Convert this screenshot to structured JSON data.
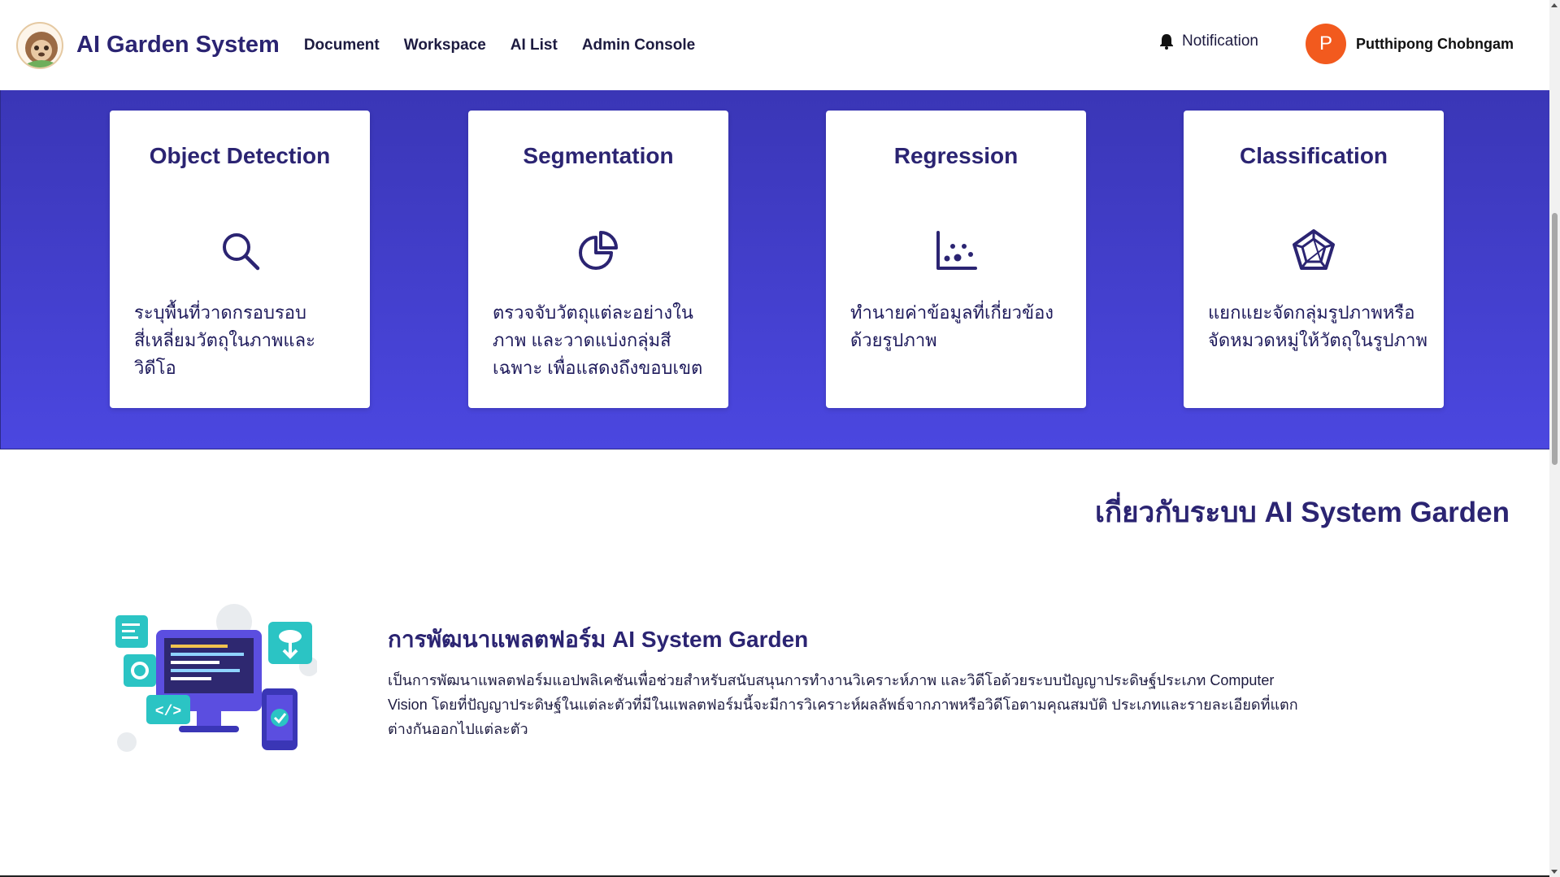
{
  "header": {
    "brand": "AI Garden System",
    "nav": [
      {
        "label": "Document"
      },
      {
        "label": "Workspace"
      },
      {
        "label": "AI List"
      },
      {
        "label": "Admin Console"
      }
    ],
    "notification_label": "Notification",
    "user": {
      "initial": "P",
      "name": "Putthipong Chobngam"
    }
  },
  "cards": [
    {
      "title": "Object Detection",
      "icon": "magnifier-icon",
      "description": "ระบุพื้นที่วาดกรอบรอบสี่เหลี่ยมวัตถุในภาพและวิดีโอ"
    },
    {
      "title": "Segmentation",
      "icon": "pie-chart-icon",
      "description": "ตรวจจับวัตถุแต่ละอย่างในภาพ และวาดแบ่งกลุ่มสีเฉพาะ เพื่อแสดงถึงขอบเขต"
    },
    {
      "title": "Regression",
      "icon": "scatter-chart-icon",
      "description": "ทำนายค่าข้อมูลที่เกี่ยวข้องด้วยรูปภาพ"
    },
    {
      "title": "Classification",
      "icon": "pentagon-network-icon",
      "description": "แยกแยะจัดกลุ่มรูปภาพหรือจัดหมวดหมู่ให้วัตถุในรูปภาพ"
    }
  ],
  "about": {
    "heading": "เกี่ยวกับระบบ AI System Garden",
    "section_title": "การพัฒนาแพลตฟอร์ม AI System Garden",
    "section_body": "เป็นการพัฒนาแพลตฟอร์มแอปพลิเคชันเพื่อช่วยสำหรับสนับสนุนการทำงานวิเคราะห์ภาพ และวิดีโอด้วยระบบปัญญาประดิษฐ์ประเภท Computer Vision โดยที่ปัญญาประดิษฐ์ในแต่ละตัวที่มีในแพลตฟอร์มนี้จะมีการวิเคราะห์ผลลัพธ์จากภาพหรือวิดีโอตามคุณสมบัติ ประเภทและรายละเอียดที่แตกต่างกันออกไปแต่ละตัว"
  },
  "colors": {
    "brand": "#2b2472",
    "hero_top": "#3a36b6",
    "hero_bottom": "#4b47e0",
    "avatar": "#f25a1e"
  }
}
